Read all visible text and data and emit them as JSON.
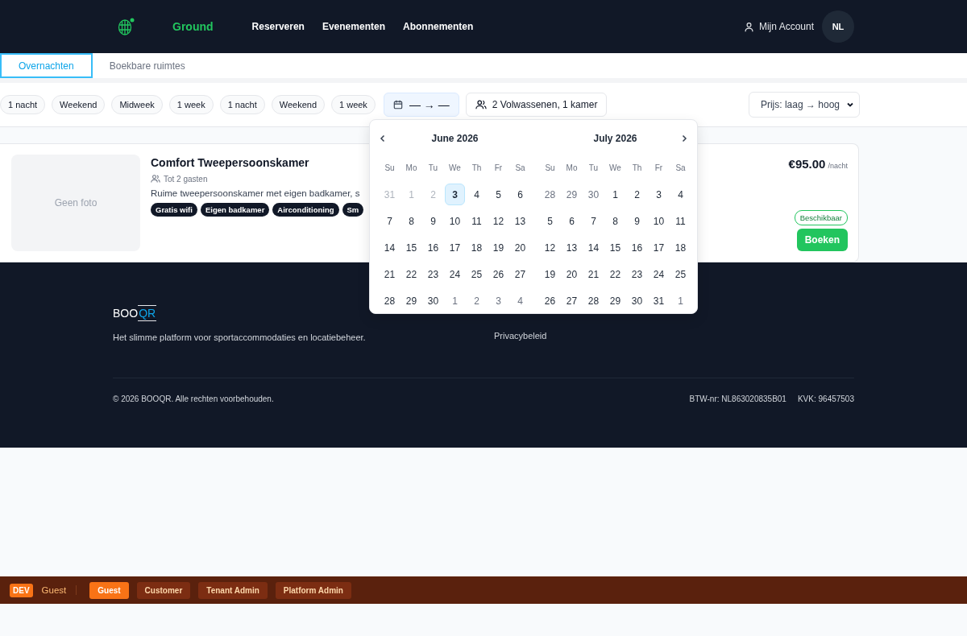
{
  "nav": {
    "brand": "Ground",
    "links": [
      "Reserveren",
      "Evenementen",
      "Abonnementen"
    ],
    "account": "Mijn Account",
    "language": "NL"
  },
  "tabs": [
    {
      "label": "Overnachten",
      "selected": true
    },
    {
      "label": "Boekbare ruimtes",
      "selected": false
    }
  ],
  "filters": {
    "presets": [
      "1 nacht",
      "Weekend",
      "Midweek",
      "1 week",
      "1 nacht",
      "Weekend",
      "1 week"
    ],
    "date_range": "— → —",
    "guests": "2 Volwassenen, 1 kamer",
    "sort": "Prijs: laag → hoog"
  },
  "calendar": {
    "months": [
      {
        "title": "June 2026",
        "weekdays": [
          "Su",
          "Mo",
          "Tu",
          "We",
          "Th",
          "Fr",
          "Sa"
        ],
        "weeks": [
          [
            {
              "day": "31",
              "kind": "past",
              "selected": false
            },
            {
              "day": "1",
              "kind": "past",
              "selected": false
            },
            {
              "day": "2",
              "kind": "past",
              "selected": false
            },
            {
              "day": "3",
              "kind": "current",
              "selected": true
            },
            {
              "day": "4",
              "kind": "current",
              "selected": false
            },
            {
              "day": "5",
              "kind": "current",
              "selected": false
            },
            {
              "day": "6",
              "kind": "current",
              "selected": false
            }
          ],
          [
            {
              "day": "7",
              "kind": "current",
              "selected": false
            },
            {
              "day": "8",
              "kind": "current",
              "selected": false
            },
            {
              "day": "9",
              "kind": "current",
              "selected": false
            },
            {
              "day": "10",
              "kind": "current",
              "selected": false
            },
            {
              "day": "11",
              "kind": "current",
              "selected": false
            },
            {
              "day": "12",
              "kind": "current",
              "selected": false
            },
            {
              "day": "13",
              "kind": "current",
              "selected": false
            }
          ],
          [
            {
              "day": "14",
              "kind": "current",
              "selected": false
            },
            {
              "day": "15",
              "kind": "current",
              "selected": false
            },
            {
              "day": "16",
              "kind": "current",
              "selected": false
            },
            {
              "day": "17",
              "kind": "current",
              "selected": false
            },
            {
              "day": "18",
              "kind": "current",
              "selected": false
            },
            {
              "day": "19",
              "kind": "current",
              "selected": false
            },
            {
              "day": "20",
              "kind": "current",
              "selected": false
            }
          ],
          [
            {
              "day": "21",
              "kind": "current",
              "selected": false
            },
            {
              "day": "22",
              "kind": "current",
              "selected": false
            },
            {
              "day": "23",
              "kind": "current",
              "selected": false
            },
            {
              "day": "24",
              "kind": "current",
              "selected": false
            },
            {
              "day": "25",
              "kind": "current",
              "selected": false
            },
            {
              "day": "26",
              "kind": "current",
              "selected": false
            },
            {
              "day": "27",
              "kind": "current",
              "selected": false
            }
          ],
          [
            {
              "day": "28",
              "kind": "current",
              "selected": false
            },
            {
              "day": "29",
              "kind": "current",
              "selected": false
            },
            {
              "day": "30",
              "kind": "current",
              "selected": false
            },
            {
              "day": "1",
              "kind": "outside",
              "selected": false
            },
            {
              "day": "2",
              "kind": "outside",
              "selected": false
            },
            {
              "day": "3",
              "kind": "outside",
              "selected": false
            },
            {
              "day": "4",
              "kind": "outside",
              "selected": false
            }
          ]
        ]
      },
      {
        "title": "July 2026",
        "weekdays": [
          "Su",
          "Mo",
          "Tu",
          "We",
          "Th",
          "Fr",
          "Sa"
        ],
        "weeks": [
          [
            {
              "day": "28",
              "kind": "outside",
              "selected": false
            },
            {
              "day": "29",
              "kind": "outside",
              "selected": false
            },
            {
              "day": "30",
              "kind": "outside",
              "selected": false
            },
            {
              "day": "1",
              "kind": "current",
              "selected": false
            },
            {
              "day": "2",
              "kind": "current",
              "selected": false
            },
            {
              "day": "3",
              "kind": "current",
              "selected": false
            },
            {
              "day": "4",
              "kind": "current",
              "selected": false
            }
          ],
          [
            {
              "day": "5",
              "kind": "current",
              "selected": false
            },
            {
              "day": "6",
              "kind": "current",
              "selected": false
            },
            {
              "day": "7",
              "kind": "current",
              "selected": false
            },
            {
              "day": "8",
              "kind": "current",
              "selected": false
            },
            {
              "day": "9",
              "kind": "current",
              "selected": false
            },
            {
              "day": "10",
              "kind": "current",
              "selected": false
            },
            {
              "day": "11",
              "kind": "current",
              "selected": false
            }
          ],
          [
            {
              "day": "12",
              "kind": "current",
              "selected": false
            },
            {
              "day": "13",
              "kind": "current",
              "selected": false
            },
            {
              "day": "14",
              "kind": "current",
              "selected": false
            },
            {
              "day": "15",
              "kind": "current",
              "selected": false
            },
            {
              "day": "16",
              "kind": "current",
              "selected": false
            },
            {
              "day": "17",
              "kind": "current",
              "selected": false
            },
            {
              "day": "18",
              "kind": "current",
              "selected": false
            }
          ],
          [
            {
              "day": "19",
              "kind": "current",
              "selected": false
            },
            {
              "day": "20",
              "kind": "current",
              "selected": false
            },
            {
              "day": "21",
              "kind": "current",
              "selected": false
            },
            {
              "day": "22",
              "kind": "current",
              "selected": false
            },
            {
              "day": "23",
              "kind": "current",
              "selected": false
            },
            {
              "day": "24",
              "kind": "current",
              "selected": false
            },
            {
              "day": "25",
              "kind": "current",
              "selected": false
            }
          ],
          [
            {
              "day": "26",
              "kind": "current",
              "selected": false
            },
            {
              "day": "27",
              "kind": "current",
              "selected": false
            },
            {
              "day": "28",
              "kind": "current",
              "selected": false
            },
            {
              "day": "29",
              "kind": "current",
              "selected": false
            },
            {
              "day": "30",
              "kind": "current",
              "selected": false
            },
            {
              "day": "31",
              "kind": "current",
              "selected": false
            },
            {
              "day": "1",
              "kind": "outside",
              "selected": false
            }
          ]
        ]
      }
    ]
  },
  "room": {
    "photo_placeholder": "Geen foto",
    "name": "Comfort Tweepersoonskamer",
    "capacity": "Tot 2 gasten",
    "description": "Ruime tweepersoonskamer met eigen badkamer, s",
    "amenities": [
      "Gratis wifi",
      "Eigen badkamer",
      "Airconditioning",
      "Sm"
    ],
    "price": "€95.00",
    "price_unit": "/nacht",
    "availability": "Beschikbaar",
    "action": "Boeken"
  },
  "footer": {
    "logo": [
      "BOO",
      "QR"
    ],
    "tagline": "Het slimme platform voor sportaccommodaties en locatiebeheer.",
    "links": [
      "Privacybeleid"
    ],
    "copyright": "© 2026 BOOQR. Alle rechten voorbehouden.",
    "vat": "BTW-nr: NL863020835B01",
    "chamber": "KVK: 96457503"
  },
  "dev_bar": {
    "badge": "DEV",
    "current_role": "Guest",
    "roles": [
      {
        "label": "Guest",
        "selected": true
      },
      {
        "label": "Customer",
        "selected": false
      },
      {
        "label": "Tenant Admin",
        "selected": false
      },
      {
        "label": "Platform Admin",
        "selected": false
      }
    ]
  }
}
